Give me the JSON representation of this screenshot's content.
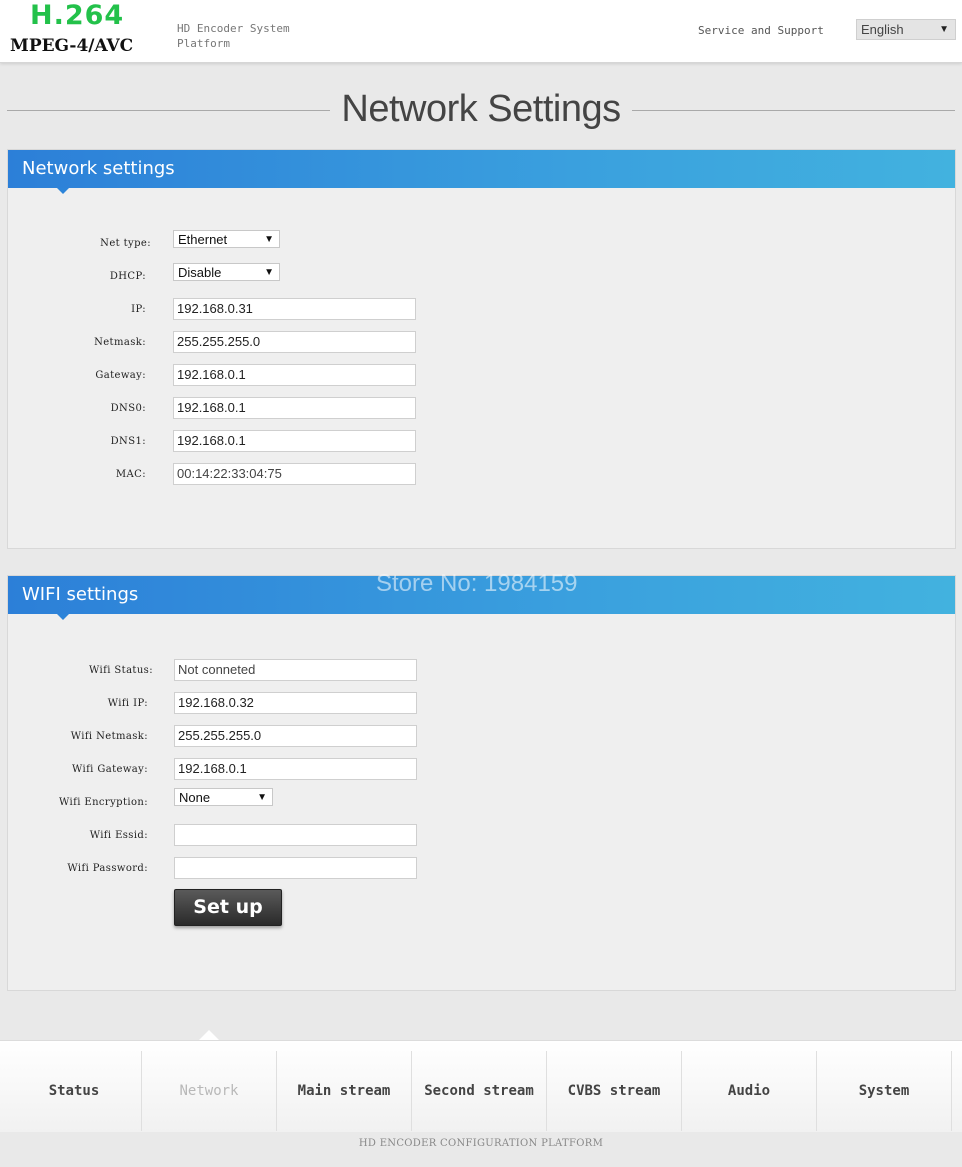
{
  "header": {
    "logo_top": "H.264",
    "logo_bottom": "MPEG-4/AVC",
    "subtitle": "HD Encoder System Platform",
    "service_link": "Service and Support",
    "language": "English"
  },
  "page_title": "Network Settings",
  "network": {
    "title": "Network settings",
    "fields": {
      "net_type": {
        "label": "Net type:",
        "value": "Ethernet"
      },
      "dhcp": {
        "label": "DHCP:",
        "value": "Disable"
      },
      "ip": {
        "label": "IP:",
        "value": "192.168.0.31"
      },
      "netmask": {
        "label": "Netmask:",
        "value": "255.255.255.0"
      },
      "gateway": {
        "label": "Gateway:",
        "value": "192.168.0.1"
      },
      "dns0": {
        "label": "DNS0:",
        "value": "192.168.0.1"
      },
      "dns1": {
        "label": "DNS1:",
        "value": "192.168.0.1"
      },
      "mac": {
        "label": "MAC:",
        "value": "00:14:22:33:04:75"
      }
    }
  },
  "wifi": {
    "title": "WIFI settings",
    "fields": {
      "status": {
        "label": "Wifi Status:",
        "value": "Not conneted"
      },
      "ip": {
        "label": "Wifi IP:",
        "value": "192.168.0.32"
      },
      "netmask": {
        "label": "Wifi Netmask:",
        "value": "255.255.255.0"
      },
      "gateway": {
        "label": "Wifi Gateway:",
        "value": "192.168.0.1"
      },
      "encryption": {
        "label": "Wifi Encryption:",
        "value": "None"
      },
      "essid": {
        "label": "Wifi Essid:",
        "value": ""
      },
      "password": {
        "label": "Wifi Password:",
        "value": ""
      }
    },
    "setup_label": "Set up"
  },
  "watermark": "Store No: 1984159",
  "nav": {
    "items": [
      "Status",
      "Network",
      "Main stream",
      "Second stream",
      "CVBS stream",
      "Audio",
      "System"
    ],
    "active": "Network"
  },
  "footer": "HD ENCODER CONFIGURATION PLATFORM"
}
